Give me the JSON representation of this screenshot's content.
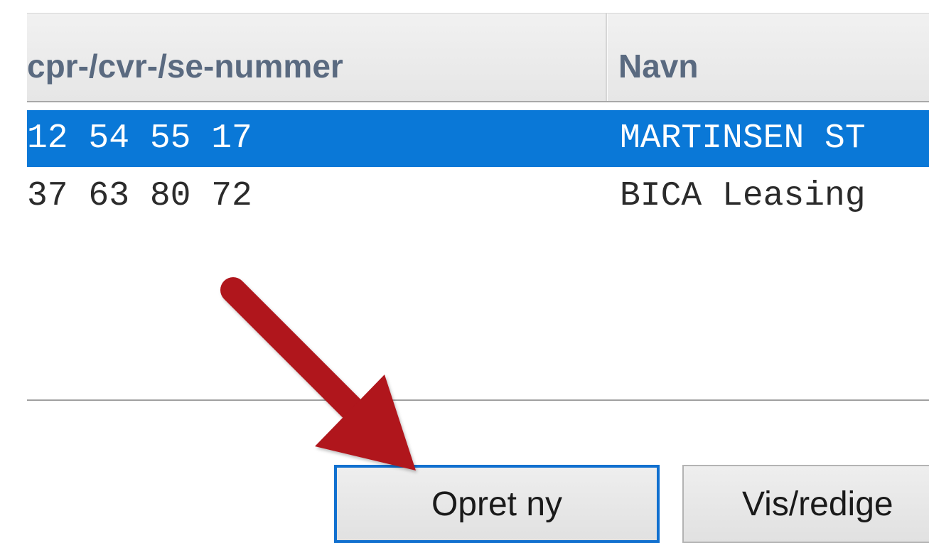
{
  "table": {
    "headers": {
      "cpr": "cpr-/cvr-/se-nummer",
      "navn": "Navn"
    },
    "rows": [
      {
        "cpr": "12 54 55 17",
        "navn": "MARTINSEN ST",
        "selected": true
      },
      {
        "cpr": "37 63 80 72",
        "navn": "BICA Leasing",
        "selected": false
      }
    ]
  },
  "buttons": {
    "opret": "Opret ny",
    "vis": "Vis/redige"
  },
  "annotation": {
    "arrow_color": "#b0151f",
    "points_to": "Opret ny"
  },
  "colors": {
    "selection": "#0a78d7",
    "focus_border": "#1170cf",
    "header_text": "#5a6a80"
  }
}
